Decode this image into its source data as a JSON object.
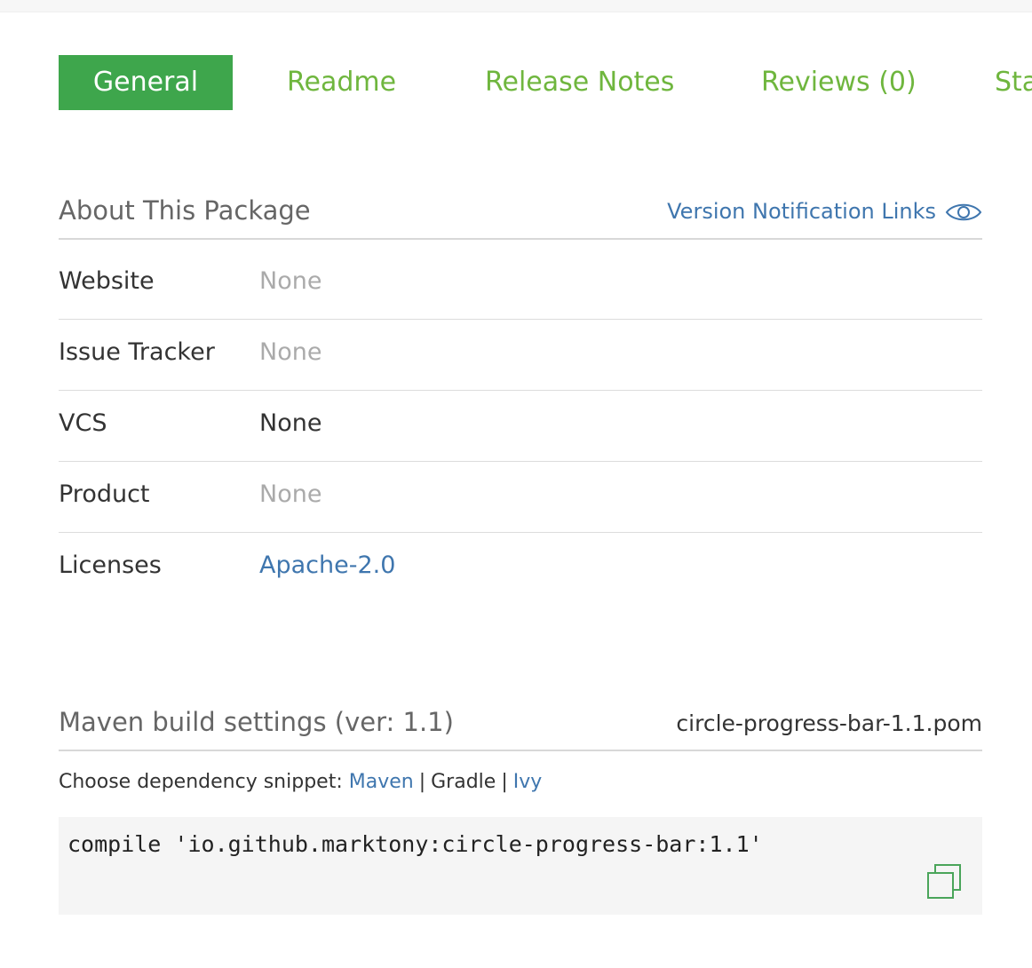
{
  "tabs": [
    {
      "label": "General",
      "active": true
    },
    {
      "label": "Readme",
      "active": false
    },
    {
      "label": "Release Notes",
      "active": false
    },
    {
      "label": "Reviews (0)",
      "active": false
    },
    {
      "label": "Sta",
      "active": false
    }
  ],
  "about": {
    "title": "About This Package",
    "notification_link": "Version Notification Links",
    "notification_icon": "eye-icon",
    "rows": [
      {
        "label": "Website",
        "value": "None"
      },
      {
        "label": "Issue Tracker",
        "value": "None"
      },
      {
        "label": "VCS",
        "value": "None"
      },
      {
        "label": "Product",
        "value": "None"
      },
      {
        "label": "Licenses",
        "value": "Apache-2.0"
      }
    ]
  },
  "maven": {
    "title": "Maven build settings (ver: 1.1)",
    "pom_file": "circle-progress-bar-1.1.pom",
    "chooser_prefix": "Choose dependency snippet:",
    "options": [
      "Maven",
      "Gradle",
      "Ivy"
    ],
    "selected": "Gradle",
    "separator": "|",
    "snippet": "compile 'io.github.marktony:circle-progress-bar:1.1'",
    "copy_icon": "copy-icon"
  },
  "colors": {
    "tab_active_bg": "#3ea64c",
    "tab_text": "#6fb63e",
    "link": "#3f76ae",
    "muted": "#aaaaaa"
  }
}
